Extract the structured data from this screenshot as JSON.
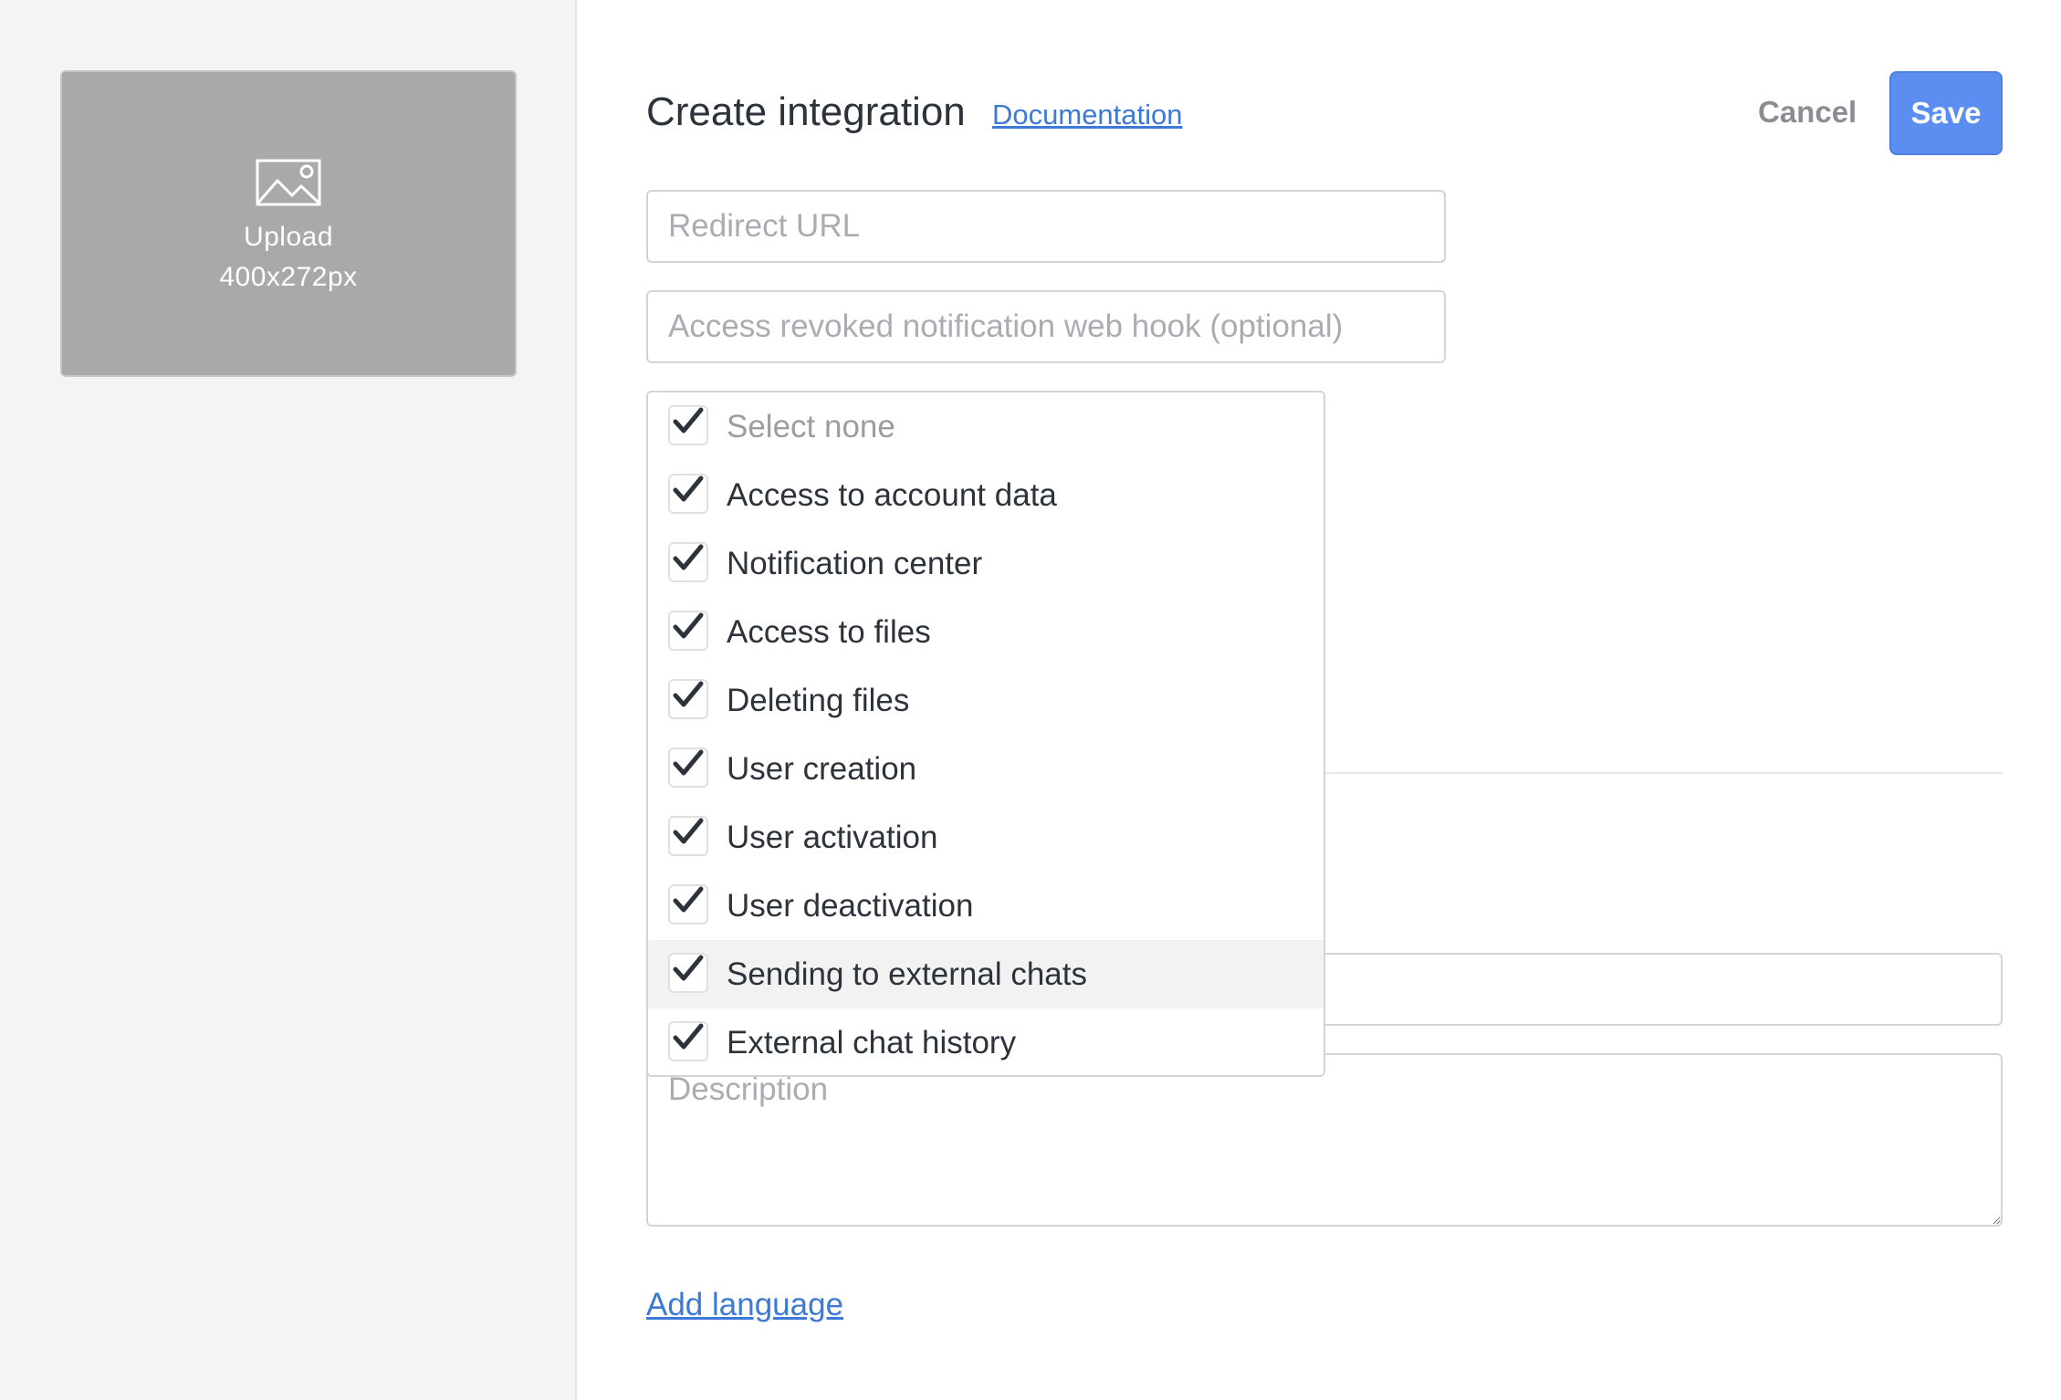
{
  "sidebar": {
    "upload": {
      "icon": "image-icon",
      "label": "Upload",
      "size": "400x272px"
    }
  },
  "header": {
    "title": "Create integration",
    "doc_link": "Documentation",
    "cancel_label": "Cancel",
    "save_label": "Save"
  },
  "form": {
    "redirect_url": {
      "value": "",
      "placeholder": "Redirect URL"
    },
    "webhook": {
      "value": "",
      "placeholder": "Access revoked notification web hook (optional)"
    },
    "description": {
      "value": "",
      "placeholder": "Description"
    },
    "add_language": "Add language"
  },
  "scopes": {
    "options": [
      {
        "label": "Select none",
        "checked": true
      },
      {
        "label": "Access to account data",
        "checked": true
      },
      {
        "label": "Notification center",
        "checked": true
      },
      {
        "label": "Access to files",
        "checked": true
      },
      {
        "label": "Deleting files",
        "checked": true
      },
      {
        "label": "User creation",
        "checked": true
      },
      {
        "label": "User activation",
        "checked": true
      },
      {
        "label": "User deactivation",
        "checked": true
      },
      {
        "label": "Sending to external chats",
        "checked": true
      },
      {
        "label": "External chat history",
        "checked": true
      }
    ]
  },
  "colors": {
    "accent": "#5b8ef0",
    "link": "#3d79d6",
    "upload_bg": "#a9a9a9",
    "sidebar_bg": "#f4f4f4"
  }
}
